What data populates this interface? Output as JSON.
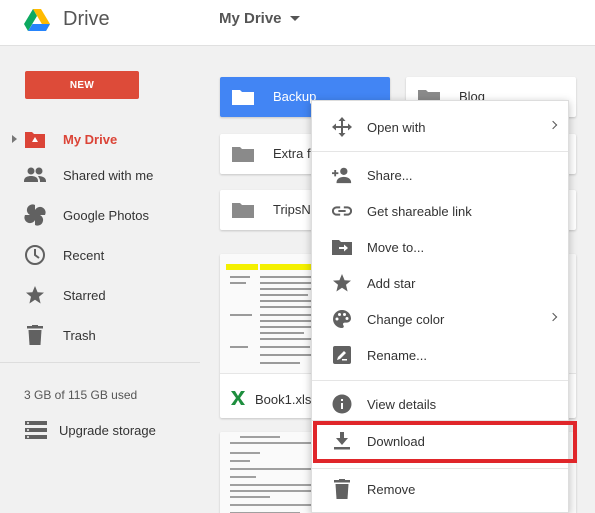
{
  "header": {
    "app_name": "Drive",
    "breadcrumb": "My Drive"
  },
  "sidebar": {
    "new_label": "NEW",
    "items": [
      {
        "label": "My Drive",
        "icon": "my-drive-icon",
        "active": true
      },
      {
        "label": "Shared with me",
        "icon": "people-icon"
      },
      {
        "label": "Google Photos",
        "icon": "photos-icon"
      },
      {
        "label": "Recent",
        "icon": "clock-icon"
      },
      {
        "label": "Starred",
        "icon": "star-icon"
      },
      {
        "label": "Trash",
        "icon": "trash-icon"
      }
    ],
    "storage": "3 GB of 115 GB used",
    "upgrade_label": "Upgrade storage"
  },
  "folders": [
    {
      "name": "Backup",
      "selected": true
    },
    {
      "name": "Blog"
    },
    {
      "name": "Extra f"
    },
    {
      "name": "TripsN"
    }
  ],
  "files": [
    {
      "name": "Book1.xls",
      "type": "spreadsheet-icon"
    }
  ],
  "context_menu": {
    "items": [
      {
        "label": "Open with",
        "icon": "move-arrows-icon",
        "submenu": true
      },
      {
        "label": "Share...",
        "icon": "add-person-icon"
      },
      {
        "label": "Get shareable link",
        "icon": "link-icon"
      },
      {
        "label": "Move to...",
        "icon": "folder-move-icon"
      },
      {
        "label": "Add star",
        "icon": "star-icon"
      },
      {
        "label": "Change color",
        "icon": "palette-icon",
        "submenu": true
      },
      {
        "label": "Rename...",
        "icon": "rename-icon"
      },
      {
        "label": "View details",
        "icon": "info-icon"
      },
      {
        "label": "Download",
        "icon": "download-icon",
        "highlighted": true
      },
      {
        "label": "Remove",
        "icon": "trash-icon"
      }
    ]
  },
  "colors": {
    "brand_red": "#dd4b39",
    "selected_blue": "#4285f4",
    "highlight_red": "#e0262a",
    "icon_gray": "#616161"
  }
}
